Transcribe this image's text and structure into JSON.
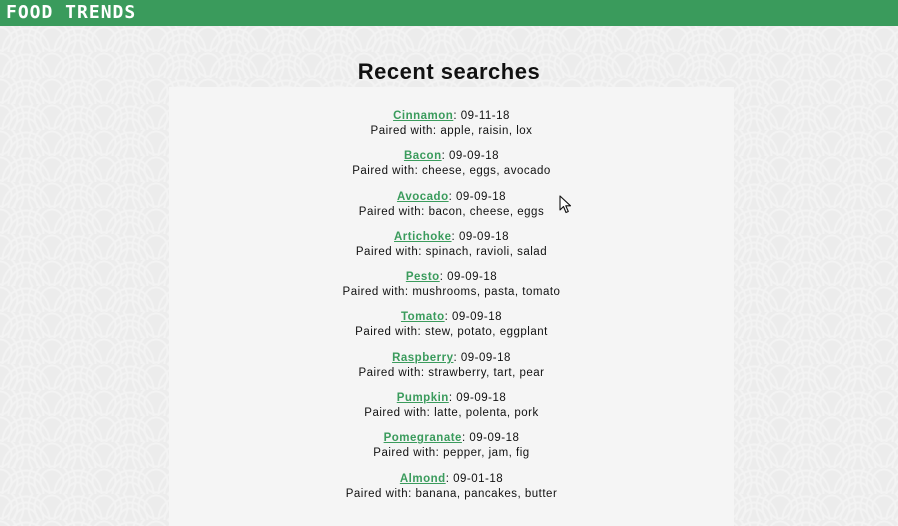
{
  "header": {
    "brand": "FOOD TRENDS"
  },
  "main": {
    "title": "Recent searches",
    "paired_prefix": "Paired with: ",
    "searches": [
      {
        "name": "Cinnamon",
        "date": "09-11-18",
        "pairings": "apple, raisin, lox"
      },
      {
        "name": "Bacon",
        "date": "09-09-18",
        "pairings": "cheese, eggs, avocado"
      },
      {
        "name": "Avocado",
        "date": "09-09-18",
        "pairings": "bacon, cheese, eggs"
      },
      {
        "name": "Artichoke",
        "date": "09-09-18",
        "pairings": "spinach, ravioli, salad"
      },
      {
        "name": "Pesto",
        "date": "09-09-18",
        "pairings": "mushrooms, pasta, tomato"
      },
      {
        "name": "Tomato",
        "date": "09-09-18",
        "pairings": "stew, potato, eggplant"
      },
      {
        "name": "Raspberry",
        "date": "09-09-18",
        "pairings": "strawberry, tart, pear"
      },
      {
        "name": "Pumpkin",
        "date": "09-09-18",
        "pairings": "latte, polenta, pork"
      },
      {
        "name": "Pomegranate",
        "date": "09-09-18",
        "pairings": "pepper, jam, fig"
      },
      {
        "name": "Almond",
        "date": "09-01-18",
        "pairings": "banana, pancakes, butter"
      }
    ]
  },
  "colors": {
    "accent": "#3a9b5c",
    "header_bar": "#3a9b5c",
    "panel": "#f5f5f5"
  },
  "icons": {
    "cursor": "mouse-pointer-icon"
  }
}
